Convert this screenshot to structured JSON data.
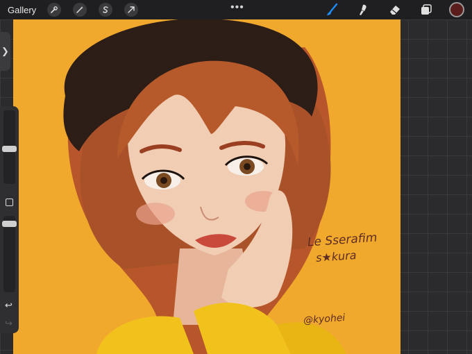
{
  "toolbar": {
    "gallery_label": "Gallery",
    "left_tools": [
      "wrench-icon",
      "magic-wand-icon",
      "selection-s-icon",
      "transform-arrow-icon"
    ],
    "more_label": "•••",
    "right_tools": [
      "brush-icon",
      "smudge-icon",
      "eraser-icon",
      "layers-icon"
    ],
    "accent_color": "#1e8cff",
    "current_color": "#5b1d1b"
  },
  "sidebar": {
    "expand_glyph": "❯",
    "brush_size_level": 0.35,
    "opacity_level": 0.5,
    "undo_glyph": "↩",
    "redo_glyph": "↪"
  },
  "artwork": {
    "signature_line1": "Le Sserafim",
    "signature_line2": "s★kura",
    "artist_tag": "@kyohei",
    "background_color": "#f0a92c"
  }
}
